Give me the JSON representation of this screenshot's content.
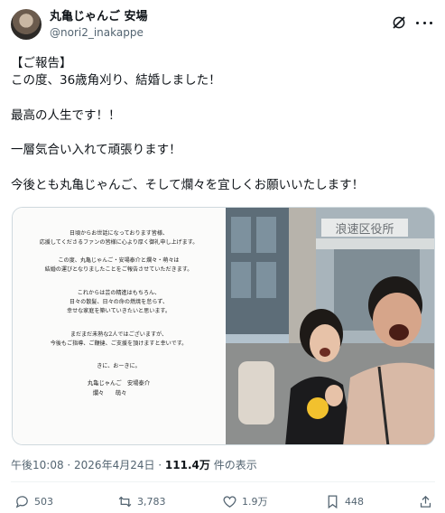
{
  "post": {
    "author": {
      "display_name": "丸亀じゃんご 安場",
      "handle": "@nori2_inakappe"
    },
    "body_lines": [
      "【ご報告】",
      "この度、36歳角刈り、結婚しました！",
      "",
      "最高の人生です！！",
      "",
      "一層気合い入れて頑張ります！",
      "",
      "今後とも丸亀じゃんご、そして爛々を宜しくお願いいたします！"
    ],
    "letter": {
      "lines": [
        "日頃からお世話になっております皆様、",
        "応援してくださるファンの皆様に心より厚く御礼申し上げます。",
        "この度、丸亀じゃんご・安場泰介と爛々・萌々は",
        "結婚の運びとなりましたことをご報告させていただきます。",
        "これからは芸の精進はもちろん、",
        "日々の散髪、日々の命の燃焼を怠らず、",
        "幸せな家庭を築いていきたいと思います。",
        "まだまだ未熟な2人ではございますが、",
        "今後もご指導、ご鞭撻、ご支援を頂けますと幸いです。",
        "きに、おーきに。"
      ],
      "signature_1": "丸亀じゃんご　安場泰介",
      "signature_2": "爛々　　萌々"
    },
    "photo_sign": "浪速区役所",
    "timestamp": "午後10:08 · 2026年4月24日 · ",
    "views_count": "111.4万",
    "views_label": " 件の表示",
    "stats": {
      "replies": "503",
      "reposts": "3,783",
      "likes": "1.9万",
      "bookmarks": "448"
    }
  },
  "colors": {
    "text": "#0f1419",
    "secondary": "#536471",
    "border": "#cfd9de"
  }
}
